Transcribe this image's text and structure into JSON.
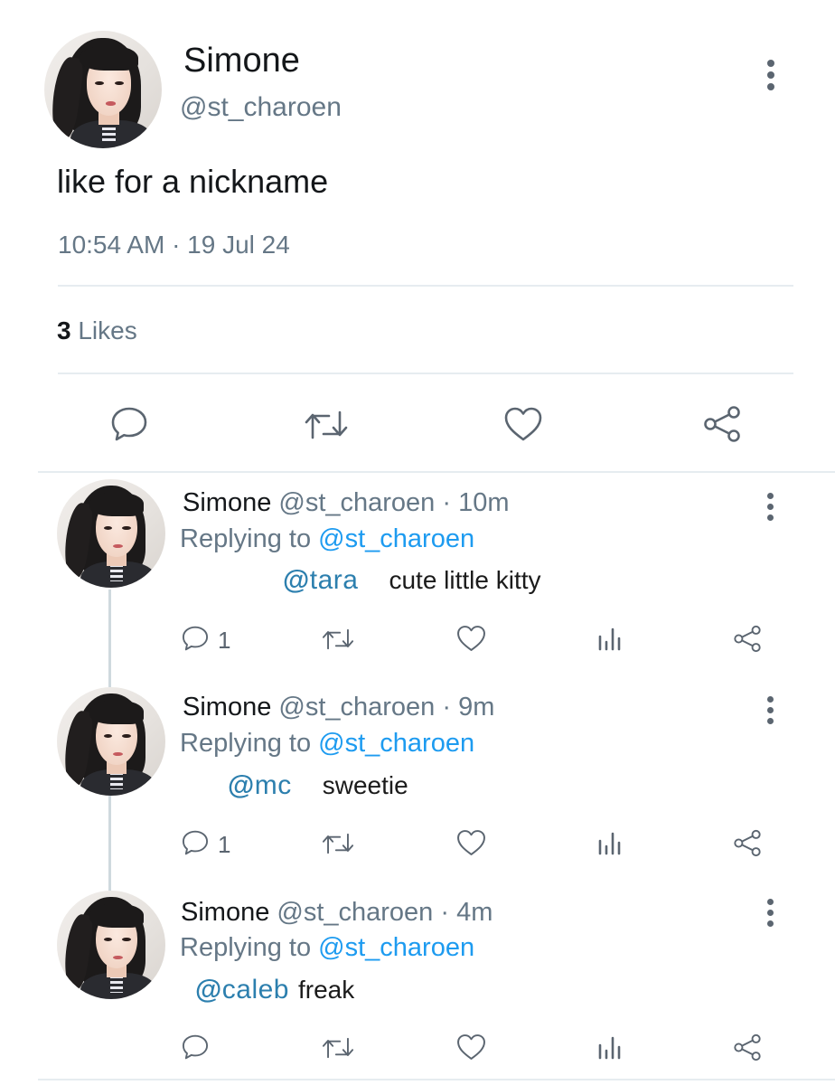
{
  "main_tweet": {
    "name": "Simone",
    "handle": "@st_charoen",
    "text": "like for a nickname",
    "timestamp": "10:54 AM · 19 Jul 24",
    "likes_count": "3",
    "likes_label": "Likes",
    "actions": [
      "reply-icon",
      "retweet-icon",
      "heart-icon",
      "share-icon"
    ],
    "menu_icon": "more-vertical-icon"
  },
  "replies": [
    {
      "name": "Simone",
      "handle_time": "@st_charoen · 10m",
      "replying_prefix": "Replying to",
      "replying_handle": "@st_charoen",
      "mention_icon": "threads-icon",
      "mention": "tara",
      "message": "cute little kitty",
      "reply_count": "1"
    },
    {
      "name": "Simone",
      "handle_time": "@st_charoen · 9m",
      "replying_prefix": "Replying to",
      "replying_handle": "@st_charoen",
      "mention_icon": "threads-icon",
      "mention": "mc",
      "message": "sweetie",
      "reply_count": "1"
    },
    {
      "name": "Simone",
      "handle_time": "@st_charoen · 4m",
      "replying_prefix": "Replying to",
      "replying_handle": "@st_charoen",
      "mention_icon": "threads-icon",
      "mention": "caleb",
      "message": "freak",
      "reply_count": ""
    }
  ],
  "colors": {
    "text": "#14171a",
    "secondary": "#657786",
    "link": "#1d9bf0",
    "mention_sticker": "#2c7fae",
    "divider": "#e6ecf0"
  }
}
